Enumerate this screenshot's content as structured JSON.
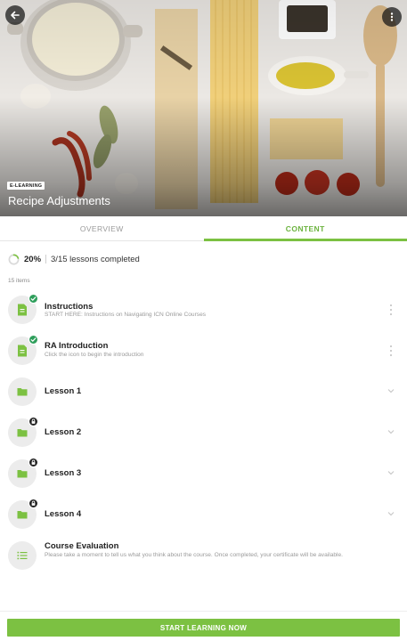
{
  "course": {
    "tag": "E-LEARNING",
    "title": "Recipe Adjustments"
  },
  "tabs": [
    {
      "label": "OVERVIEW",
      "active": false
    },
    {
      "label": "CONTENT",
      "active": true
    }
  ],
  "progress": {
    "percent_label": "20%",
    "percent_value": 0.2,
    "lessons_text": "3/15 lessons completed"
  },
  "items_count": "15 items",
  "items": [
    {
      "title": "Instructions",
      "subtitle": "START HERE: Instructions on Navigating ICN Online Courses",
      "icon": "document-icon",
      "status": "completed",
      "trailing": "more"
    },
    {
      "title": "RA Introduction",
      "subtitle": "Click the icon to begin the introduction",
      "icon": "document-icon",
      "status": "completed",
      "trailing": "more"
    },
    {
      "title": "Lesson 1",
      "subtitle": "",
      "icon": "folder-icon",
      "status": "unlocked",
      "trailing": "expand"
    },
    {
      "title": "Lesson 2",
      "subtitle": "",
      "icon": "folder-icon",
      "status": "locked",
      "trailing": "expand"
    },
    {
      "title": "Lesson 3",
      "subtitle": "",
      "icon": "folder-icon",
      "status": "locked",
      "trailing": "expand"
    },
    {
      "title": "Lesson 4",
      "subtitle": "",
      "icon": "folder-icon",
      "status": "locked",
      "trailing": "expand"
    },
    {
      "title": "Course Evaluation",
      "subtitle": "Please take a moment to tell us what you think about the course. Once completed, your certificate will be available.",
      "icon": "list-icon",
      "status": "none",
      "trailing": "none"
    }
  ],
  "cta_label": "START LEARNING NOW",
  "colors": {
    "accent": "#7cc142",
    "completed": "#2e9e5b",
    "locked": "#222222"
  }
}
